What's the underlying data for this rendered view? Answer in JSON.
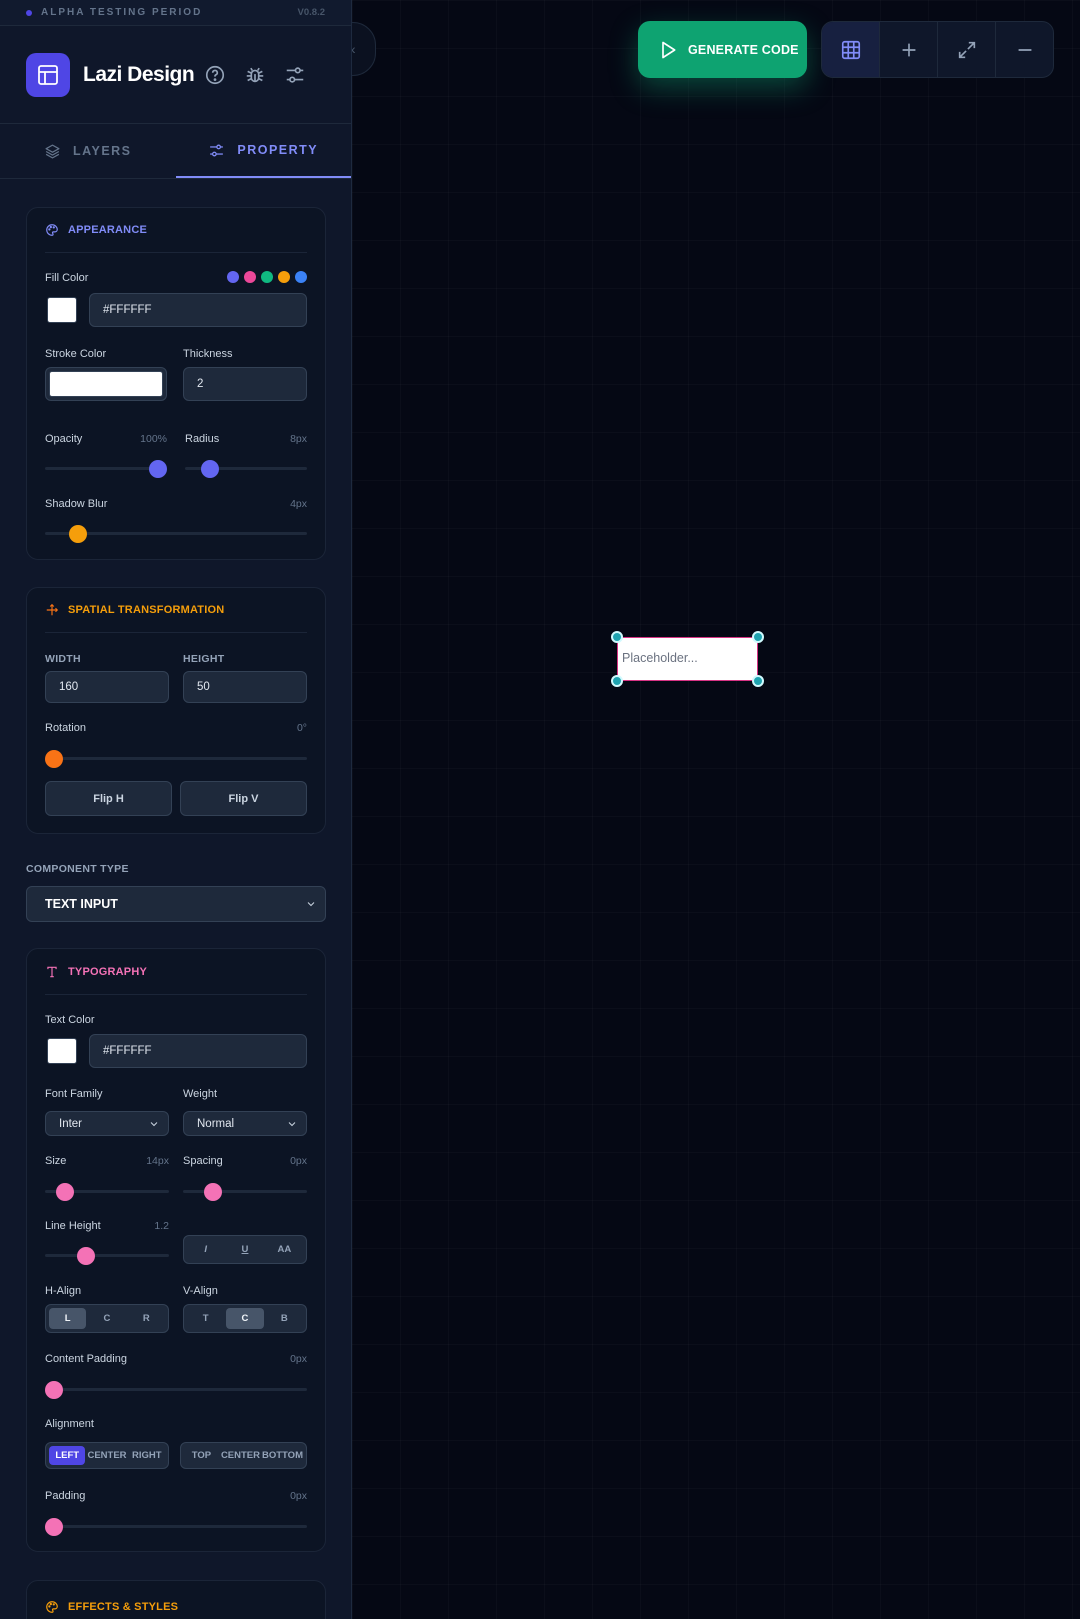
{
  "colors": {
    "accent": "#4f46e5",
    "green": "#10b981",
    "appearance": "#818cf8",
    "spatial": "#f59e0b",
    "typography": "#f472b6",
    "effects": "#f59e0b",
    "handle": "#1fa3b0",
    "selection": "#d63384"
  },
  "alpha": {
    "label": "ALPHA TESTING PERIOD",
    "version": "V0.8.2"
  },
  "brand": {
    "title": "Lazi Design",
    "logo_icon": "layout-icon",
    "icons": [
      "help-circle-icon",
      "bug-icon",
      "sliders-icon"
    ]
  },
  "tabs": [
    {
      "label": "LAYERS",
      "icon": "layers-icon",
      "active": false
    },
    {
      "label": "PROPERTY",
      "icon": "sliders-icon",
      "active": true
    }
  ],
  "appearance": {
    "title": "APPEARANCE",
    "fill_label": "Fill Color",
    "fill_value": "#FFFFFF",
    "presets": [
      "#6366f1",
      "#ec4899",
      "#10b981",
      "#f59e0b",
      "#3b82f6"
    ],
    "stroke_label": "Stroke Color",
    "thickness_label": "Thickness",
    "thickness_value": "2",
    "opacity_label": "Opacity",
    "opacity_value": "100%",
    "opacity_level": 1.0,
    "radius_label": "Radius",
    "radius_value": "8px",
    "radius_level": 0.15,
    "shadow_label": "Shadow Blur",
    "shadow_value": "4px",
    "shadow_level": 0.1
  },
  "spatial": {
    "title": "SPATIAL TRANSFORMATION",
    "width_label": "WIDTH",
    "width_value": "160",
    "height_label": "HEIGHT",
    "height_value": "50",
    "rotation_label": "Rotation",
    "rotation_value": "0°",
    "rotation_level": 0.0,
    "flip_h": "Flip H",
    "flip_v": "Flip V"
  },
  "component": {
    "label": "COMPONENT TYPE",
    "value": "TEXT INPUT"
  },
  "typography": {
    "title": "TYPOGRAPHY",
    "text_color_label": "Text Color",
    "text_color_value": "#FFFFFF",
    "font_family_label": "Font Family",
    "font_family_value": "Inter",
    "weight_label": "Weight",
    "weight_value": "Normal",
    "size_label": "Size",
    "size_value": "14px",
    "size_level": 0.1,
    "spacing_label": "Spacing",
    "spacing_value": "0px",
    "spacing_level": 0.2,
    "line_height_label": "Line Height",
    "line_height_value": "1.2",
    "line_height_level": 0.3,
    "style_buttons": [
      "I",
      "U",
      "AA"
    ],
    "h_align_label": "H-Align",
    "h_align": [
      "L",
      "C",
      "R"
    ],
    "v_align_label": "V-Align",
    "v_align": [
      "T",
      "C",
      "B"
    ],
    "content_padding_label": "Content Padding",
    "content_padding_value": "0px",
    "content_padding_level": 0.0,
    "alignment_label": "Alignment",
    "alignment_h": [
      "LEFT",
      "CENTER",
      "RIGHT"
    ],
    "alignment_v": [
      "TOP",
      "CENTER",
      "BOTTOM"
    ],
    "padding_label": "Padding",
    "padding_value": "0px",
    "padding_level": 0.0
  },
  "effects": {
    "title": "EFFECTS & STYLES"
  },
  "canvas": {
    "generate_label": "GENERATE CODE",
    "tools": [
      "grid-icon",
      "plus-icon",
      "expand-icon",
      "minus-icon"
    ],
    "element_placeholder": "Placeholder..."
  }
}
